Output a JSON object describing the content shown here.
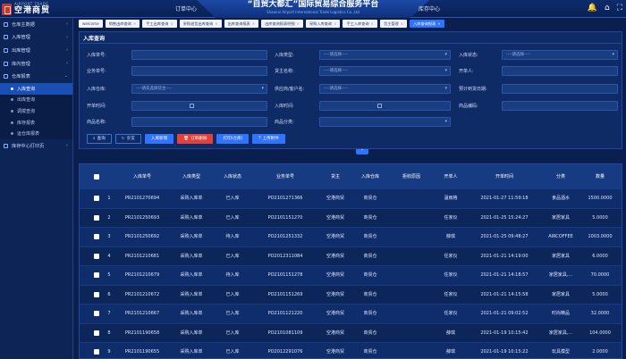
{
  "header": {
    "logo_en": "AIRPORT TRADE",
    "logo_cn": "空港商贸",
    "title_cn": "“自贸大都汇”国际贸易综合服务平台",
    "title_en": "Shaanxi Airport International Trade Logistics Co.,Ltd",
    "nav_left": "订单中心",
    "nav_right": "库存中心",
    "icons": [
      "bell-icon",
      "home-icon",
      "fullscreen-icon"
    ]
  },
  "sidebar": {
    "items": [
      {
        "label": "仓库主数据",
        "icon": "warehouse-icon"
      },
      {
        "label": "入库管理",
        "icon": "inbound-icon"
      },
      {
        "label": "出库管理",
        "icon": "outbound-icon"
      },
      {
        "label": "库内管理",
        "icon": "inventory-icon"
      },
      {
        "label": "仓库报表",
        "icon": "report-icon"
      }
    ],
    "subitems": [
      {
        "label": "入库查询",
        "active": true
      },
      {
        "label": "出库查询",
        "active": false
      },
      {
        "label": "调拨查询",
        "active": false
      },
      {
        "label": "库存报表",
        "active": false
      },
      {
        "label": "运仓库报表",
        "active": false
      }
    ],
    "last_item": {
      "label": "库存中心打印页",
      "icon": "print-icon"
    }
  },
  "tabs": [
    {
      "label": "welcome",
      "active": false
    },
    {
      "label": "销售出库查询",
      "active": false
    },
    {
      "label": "手工出库查询",
      "active": false
    },
    {
      "label": "采购退货出库查询",
      "active": false
    },
    {
      "label": "出库查询报表",
      "active": false
    },
    {
      "label": "出库查询报表明细",
      "active": false
    },
    {
      "label": "采购入库查询",
      "active": false
    },
    {
      "label": "手工入库查询",
      "active": false
    },
    {
      "label": "货主管理",
      "active": false
    },
    {
      "label": "入库查询报表",
      "active": true
    }
  ],
  "query": {
    "title": "入库查询",
    "fields": {
      "inbound_no": "入库单号:",
      "business_no": "业务单号:",
      "warehouse": "入库仓库:",
      "warehouse_placeholder": "----请先选择货主----",
      "start_time": "开单时间:",
      "product_name": "商品名称:",
      "inbound_type": "入库类型:",
      "owner_name": "货主名称:",
      "supplier": "供应商/客户名:",
      "inbound_time": "入库时间:",
      "category": "商品分类:",
      "inbound_status": "入库状态:",
      "opener": "开单人:",
      "expected_date": "预计到货日期:",
      "product_code": "商品编码:",
      "select_placeholder": "----请选择----"
    },
    "buttons": {
      "query": "查询",
      "reset": "重置",
      "add": "入库新增",
      "delete": "订单删除",
      "print": "打印(仓库)",
      "upload": "上传附件"
    }
  },
  "table": {
    "headers": [
      "",
      "入库单号",
      "入库类型",
      "入库状态",
      "业务单号",
      "货主",
      "入库仓库",
      "拒收原因",
      "开单人",
      "开单时间",
      "分类",
      "数量"
    ],
    "rows": [
      {
        "no": "1",
        "inbound_no": "PR2101270694",
        "type": "采购入库单",
        "status": "已入库",
        "business_no": "PO2101271366",
        "owner": "空港商贸",
        "warehouse": "商贸仓",
        "reject": "",
        "opener": "温雨格",
        "time": "2021-01-27 11:59:18",
        "category": "食品酒水",
        "qty": "1500.0000"
      },
      {
        "no": "2",
        "inbound_no": "PR2101250693",
        "type": "采购入库单",
        "status": "已入库",
        "business_no": "PO2101151270",
        "owner": "空港商贸",
        "warehouse": "商贸仓",
        "reject": "",
        "opener": "任家仪",
        "time": "2021-01-25 15:24:27",
        "category": "家居家具",
        "qty": "5.0000"
      },
      {
        "no": "3",
        "inbound_no": "PR2101250692",
        "type": "采购入库单",
        "status": "待入库",
        "business_no": "PO2101251332",
        "owner": "空港商贸",
        "warehouse": "商贸仓",
        "reject": "",
        "opener": "薛琪",
        "time": "2021-01-25 09:48:27",
        "category": "AIRCOFFEE",
        "qty": "1003.0000"
      },
      {
        "no": "4",
        "inbound_no": "PR2101210681",
        "type": "采购入库单",
        "status": "已入库",
        "business_no": "PO2012311084",
        "owner": "空港商贸",
        "warehouse": "商贸仓",
        "reject": "",
        "opener": "任家仪",
        "time": "2021-01-21 14:19:00",
        "category": "家居家具",
        "qty": "6.0000"
      },
      {
        "no": "5",
        "inbound_no": "PR2101210679",
        "type": "采购入库单",
        "status": "待入库",
        "business_no": "PO2101151278",
        "owner": "空港商贸",
        "warehouse": "商贸仓",
        "reject": "",
        "opener": "任家仪",
        "time": "2021-01-21 14:18:57",
        "category": "家居家具,...",
        "qty": "70.0000"
      },
      {
        "no": "6",
        "inbound_no": "PR2101210672",
        "type": "采购入库单",
        "status": "已入库",
        "business_no": "PO2101151269",
        "owner": "空港商贸",
        "warehouse": "商贸仓",
        "reject": "",
        "opener": "任家仪",
        "time": "2021-01-21 14:15:58",
        "category": "家居家具",
        "qty": "5.0000"
      },
      {
        "no": "7",
        "inbound_no": "PR2101210667",
        "type": "采购入库单",
        "status": "已入库",
        "business_no": "PO2101121220",
        "owner": "空港商贸",
        "warehouse": "商贸仓",
        "reject": "",
        "opener": "任家仪",
        "time": "2021-01-21 09:02:52",
        "category": "时尚精品",
        "qty": "32.0000"
      },
      {
        "no": "8",
        "inbound_no": "PR2101190658",
        "type": "采购入库单",
        "status": "已入库",
        "business_no": "PO2101081109",
        "owner": "空港商贸",
        "warehouse": "商贸仓",
        "reject": "",
        "opener": "薛琪",
        "time": "2021-01-19 10:15:42",
        "category": "家居家具,...",
        "qty": "104.0000"
      },
      {
        "no": "9",
        "inbound_no": "PR2101190655",
        "type": "采购入库单",
        "status": "已入库",
        "business_no": "PO2012291076",
        "owner": "空港商贸",
        "warehouse": "商贸仓",
        "reject": "",
        "opener": "薛琪",
        "time": "2021-01-19 10:15:22",
        "category": "玩具模型",
        "qty": "2.0000"
      }
    ]
  }
}
